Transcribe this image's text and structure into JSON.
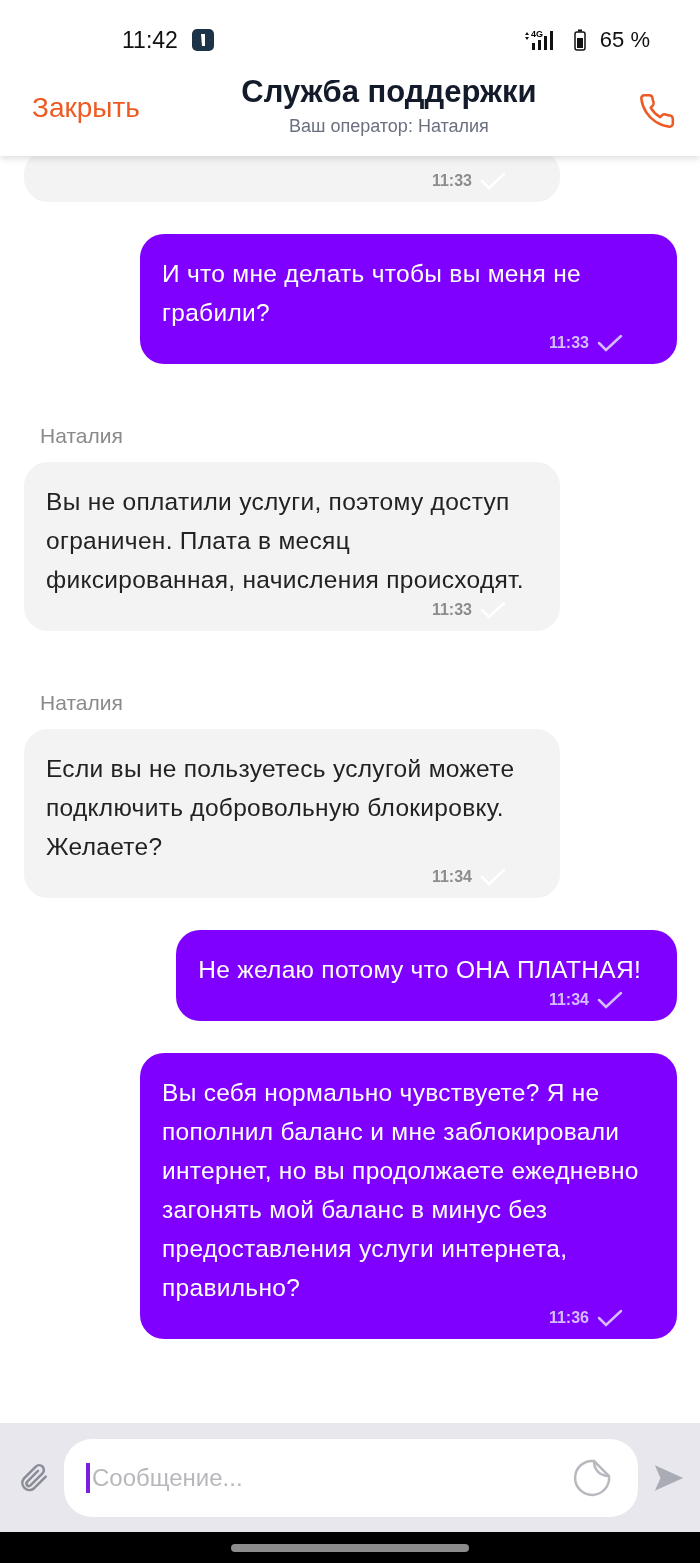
{
  "status_bar": {
    "time": "11:42",
    "network": "4G",
    "battery": "65 %"
  },
  "header": {
    "close": "Закрыть",
    "title": "Служба поддержки",
    "subtitle": "Ваш оператор: Наталия"
  },
  "messages": [
    {
      "kind": "incoming",
      "time": "11:33"
    },
    {
      "kind": "outgoing",
      "text": "И что мне делать чтобы вы меня не грабили?",
      "time": "11:33"
    },
    {
      "kind": "incoming",
      "author": "Наталия",
      "text": "Вы не оплатили услуги, поэтому доступ ограничен. Плата в месяц фиксированная, начисления происходят.",
      "time": "11:33"
    },
    {
      "kind": "incoming",
      "author": "Наталия",
      "text": "Если вы не пользуетесь услугой можете подключить добровольную блокировку. Желаете?",
      "time": "11:34"
    },
    {
      "kind": "outgoing",
      "text": "Не желаю потому что ОНА ПЛАТНАЯ!",
      "time": "11:34"
    },
    {
      "kind": "outgoing",
      "text": "Вы себя нормально чувствуете? Я не пополнил баланс и мне заблокировали интернет, но вы продолжаете ежедневно загонять мой баланс в минус без предоставления услуги интернета, правильно?",
      "time": "11:36"
    }
  ],
  "composer": {
    "placeholder": "Сообщение..."
  }
}
